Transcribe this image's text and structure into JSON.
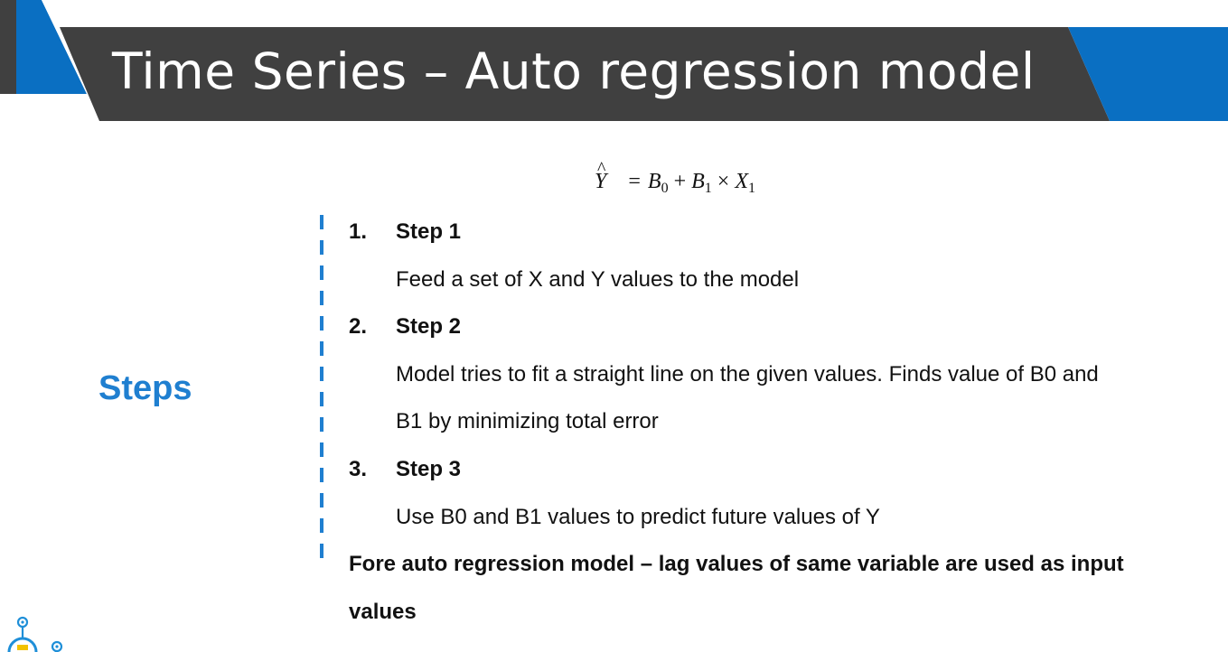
{
  "title": "Time Series – Auto regression model",
  "side_label": "Steps",
  "formula": {
    "y_hat": "Y",
    "equals": "=",
    "b0": "B",
    "b0_sub": "0",
    "plus": "+",
    "b1": "B",
    "b1_sub": "1",
    "times": "×",
    "x1": "X",
    "x1_sub": "1"
  },
  "steps": [
    {
      "number": "1.",
      "heading": "Step 1",
      "description": "Feed a set of X and Y values to the model"
    },
    {
      "number": "2.",
      "heading": "Step 2",
      "description": "Model tries to fit a straight line on the given values. Finds value of B0 and\nB1 by minimizing total error"
    },
    {
      "number": "3.",
      "heading": "Step 3",
      "description": "Use B0 and B1 values to predict future values of Y"
    }
  ],
  "note": "Fore auto regression model – lag values of same variable are used as input values",
  "colors": {
    "header_dark": "#404040",
    "header_blue": "#0a6fc2",
    "accent": "#1f7fd0"
  },
  "icons": {
    "corner": "robot-logo-icon"
  }
}
